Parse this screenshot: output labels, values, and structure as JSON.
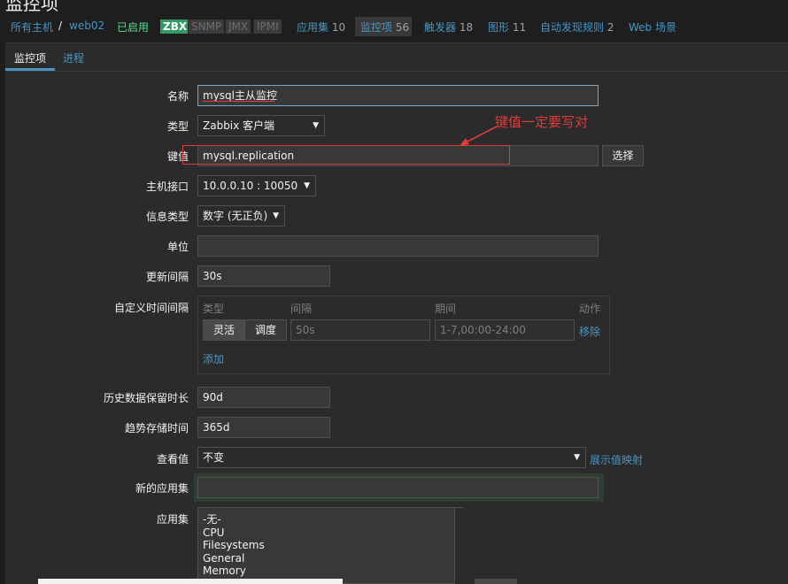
{
  "page": {
    "title": "监控项"
  },
  "nav": {
    "all_hosts": "所有主机",
    "sep": "/",
    "host": "web02",
    "status": "已启用",
    "tags": [
      "ZBX",
      "SNMP",
      "JMX",
      "IPMI"
    ],
    "items": [
      {
        "label": "应用集",
        "count": "10"
      },
      {
        "label": "监控项",
        "count": "56"
      },
      {
        "label": "触发器",
        "count": "18"
      },
      {
        "label": "图形",
        "count": "11"
      },
      {
        "label": "自动发现规则",
        "count": "2"
      },
      {
        "label": "Web 场景",
        "count": ""
      }
    ]
  },
  "tabs": [
    "监控项",
    "进程"
  ],
  "form": {
    "name": {
      "label": "名称",
      "value": "mysql主从监控"
    },
    "type": {
      "label": "类型",
      "value": "Zabbix 客户端"
    },
    "key": {
      "label": "键值",
      "value": "mysql.replication",
      "button": "选择"
    },
    "interface": {
      "label": "主机接口",
      "value": "10.0.0.10 : 10050"
    },
    "info_type": {
      "label": "信息类型",
      "value": "数字 (无正负)"
    },
    "units": {
      "label": "单位",
      "value": ""
    },
    "delay": {
      "label": "更新间隔",
      "value": "30s"
    },
    "custom_intervals": {
      "label": "自定义时间间隔",
      "headers": {
        "type": "类型",
        "interval": "间隔",
        "period": "期间",
        "action": "动作"
      },
      "toggle": [
        "灵活",
        "调度"
      ],
      "interval_value": "50s",
      "period_value": "1-7,00:00-24:00",
      "remove": "移除",
      "add": "添加"
    },
    "history": {
      "label": "历史数据保留时长",
      "value": "90d"
    },
    "trends": {
      "label": "趋势存储时间",
      "value": "365d"
    },
    "valuemap": {
      "label": "查看值",
      "value": "不变",
      "link": "展示值映射"
    },
    "new_app": {
      "label": "新的应用集",
      "value": ""
    },
    "apps": {
      "label": "应用集",
      "options": [
        "-无-",
        "CPU",
        "Filesystems",
        "General",
        "Memory"
      ]
    }
  },
  "annotation": {
    "text": "键值一定要写对"
  },
  "colors": {
    "accent": "#4796c4",
    "annotation": "#e03a3a",
    "enabled": "#59db8f",
    "zbx": "#339966"
  }
}
